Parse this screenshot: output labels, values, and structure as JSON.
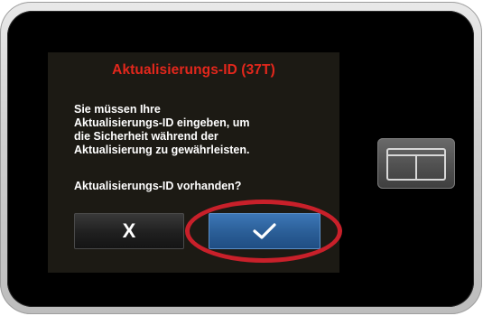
{
  "dialog": {
    "title": "Aktualisierungs-ID (37T)",
    "body_lines": [
      "Sie müssen Ihre",
      "Aktualisierungs-ID eingeben, um",
      "die Sicherheit während der",
      "Aktualisierung zu gewährleisten."
    ],
    "question": "Aktualisierungs-ID vorhanden?",
    "cancel_label": "X",
    "confirm_icon": "checkmark-icon"
  },
  "hardware": {
    "button_icon": "t-logo-icon"
  },
  "colors": {
    "title": "#e3271c",
    "screen_background": "#1c1a14",
    "confirm_button": "#2a5d96",
    "cancel_button": "#1f1f1f",
    "highlight": "#c8202a"
  }
}
